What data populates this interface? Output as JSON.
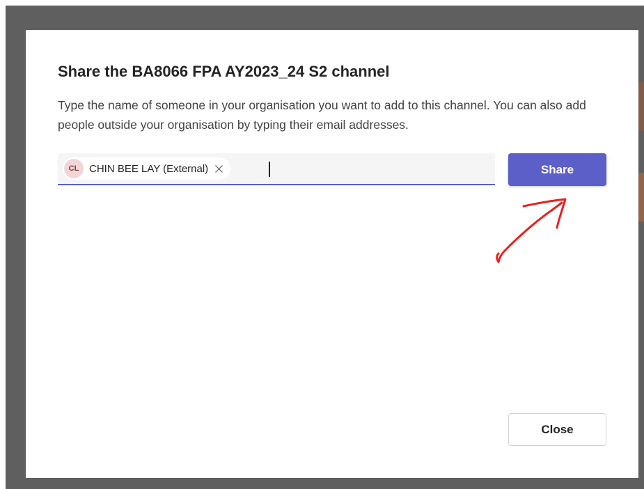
{
  "dialog": {
    "title": "Share the BA8066 FPA AY2023_24 S2 channel",
    "description": "Type the name of someone in your organisation you want to add to this channel. You can also add people outside your organisation by typing their email addresses.",
    "people_picker": {
      "selected": [
        {
          "initials": "CL",
          "label": "CHIN BEE LAY (External)"
        }
      ],
      "value": ""
    },
    "share_label": "Share",
    "close_label": "Close"
  },
  "colors": {
    "accent": "#5b5fc7",
    "annotation": "#e8201e",
    "avatar_bg": "#f0d6d8",
    "overlay": "#5f5f5f"
  },
  "icons": {
    "pill_remove": "close-icon"
  },
  "annotation": {
    "shape": "hand-drawn-arrow",
    "points_to": "share-button"
  }
}
